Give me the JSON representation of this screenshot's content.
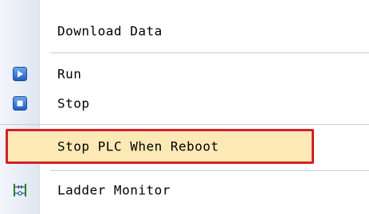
{
  "menu": {
    "items": [
      {
        "label": "Download Data",
        "icon": null
      },
      {
        "label": "Run",
        "icon": "play-icon"
      },
      {
        "label": "Stop",
        "icon": "stop-icon"
      },
      {
        "label": "Stop PLC When Reboot",
        "icon": null,
        "highlighted": true
      },
      {
        "label": "Ladder Monitor",
        "icon": "ladder-monitor-icon"
      }
    ]
  },
  "colors": {
    "highlight_bg": "#fde9b6",
    "highlight_border": "#d42028",
    "icon_blue": "#2b6fd2",
    "gutter": "#dfe6f1"
  }
}
